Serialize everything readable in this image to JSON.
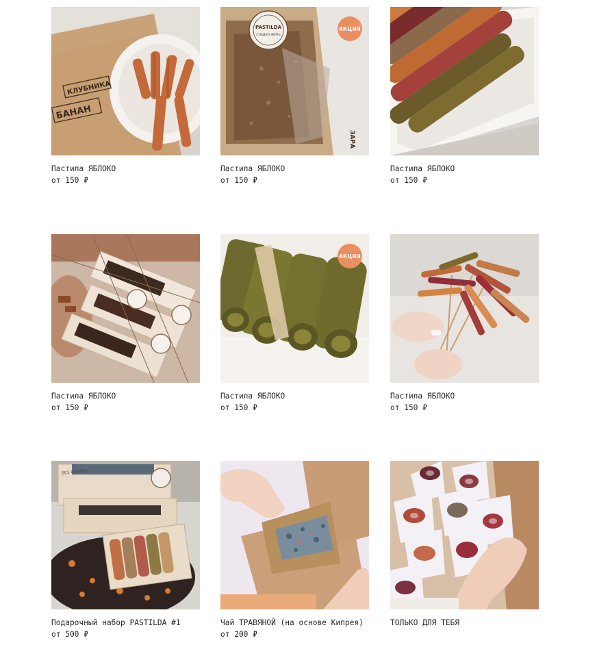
{
  "products": [
    {
      "title": "Пастила ЯБЛОКО",
      "price": "от 150 ₽",
      "badge": "",
      "image": "kraft-bag-strawberry-banana-rolls"
    },
    {
      "title": "Пастила ЯБЛОКО",
      "price": "от 150 ₽",
      "badge": "АКЦИЯ",
      "image": "pastilda-bag-brown-rolls"
    },
    {
      "title": "Пастила ЯБЛОКО",
      "price": "от 150 ₽",
      "badge": "",
      "image": "box-colorful-rolls"
    },
    {
      "title": "Пастила ЯБЛОКО",
      "price": "от 150 ₽",
      "badge": "",
      "image": "gift-boxes-twine"
    },
    {
      "title": "Пастила ЯБЛОКО",
      "price": "от 150 ₽",
      "badge": "АКЦИЯ",
      "image": "green-rolls-row"
    },
    {
      "title": "Пастила ЯБЛОКО",
      "price": "от 150 ₽",
      "badge": "",
      "image": "roll-bouquet-hands"
    },
    {
      "title": "Подарочный набор PASTILDA #1",
      "price": "от 500 ₽",
      "badge": "",
      "image": "gift-set-with-tea"
    },
    {
      "title": "Чай ТРАВЯНОЙ (на основе Кипрея)",
      "price": "от 200 ₽",
      "badge": "",
      "image": "herbal-tea-bag-hands"
    },
    {
      "title": "ТОЛЬКО ДЛЯ ТЕБЯ",
      "price": "",
      "badge": "",
      "image": "paper-cone-bouquet"
    }
  ],
  "image_labels": {
    "bag_line1": "КЛУБНИКА",
    "bag_line2": "БАНАН",
    "bag_partial": "ЗАРА",
    "seal_brand": "PASTILDA",
    "seal_sub": "СЛАДКО ЖИТЬ",
    "box_label": "БЕЗ САХАРА"
  },
  "colors": {
    "badge": "#ea8f61",
    "text": "#262626",
    "background": "#ffffff"
  }
}
